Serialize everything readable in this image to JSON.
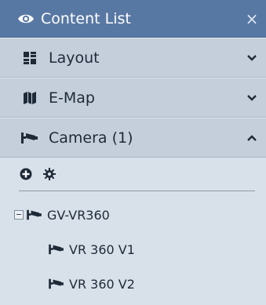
{
  "panel": {
    "title": "Content List",
    "title_icon": "eye-icon",
    "close_glyph": "×"
  },
  "sections": [
    {
      "label": "Layout",
      "icon": "layout-grid-icon",
      "state": "collapsed"
    },
    {
      "label": "E-Map",
      "icon": "map-icon",
      "state": "collapsed"
    },
    {
      "label": "Camera (1)",
      "icon": "camera-icon",
      "state": "expanded"
    }
  ],
  "toolbar": {
    "add_icon": "add-circle-icon",
    "settings_icon": "gear-icon"
  },
  "tree": {
    "root": {
      "label": "GV-VR360",
      "expanded": true
    },
    "children": [
      {
        "label": "VR 360 V1"
      },
      {
        "label": "VR 360 V2"
      }
    ]
  },
  "colors": {
    "titlebar": "#5878a4",
    "section_bg": "#c5cfdb",
    "panel_bg": "#d8e0e9",
    "text": "#1e2a38"
  }
}
